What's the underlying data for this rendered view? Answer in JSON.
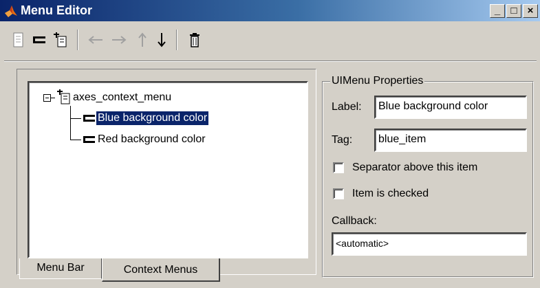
{
  "window": {
    "title": "Menu Editor",
    "controls": {
      "minimize": "_",
      "maximize": "□",
      "close": "×"
    }
  },
  "toolbar": {
    "icons": [
      "new-menu-icon",
      "new-menu-item-icon",
      "new-context-menu-icon",
      "move-left-icon",
      "move-right-icon",
      "move-up-icon",
      "move-down-icon",
      "delete-icon"
    ]
  },
  "tree": {
    "root": {
      "label": "axes_context_menu",
      "expanded": true
    },
    "items": [
      {
        "label": "Blue background color",
        "selected": true
      },
      {
        "label": "Red background color",
        "selected": false
      }
    ]
  },
  "tabs": [
    {
      "label": "Menu Bar",
      "active": false
    },
    {
      "label": "Context Menus",
      "active": true
    }
  ],
  "properties": {
    "group_title": "UIMenu Properties",
    "label_caption": "Label:",
    "label_value": "Blue background color",
    "tag_caption": "Tag:",
    "tag_value": "blue_item",
    "separator_caption": "Separator above this item",
    "separator_checked": false,
    "checked_caption": "Item is checked",
    "checked_checked": false,
    "callback_caption": "Callback:",
    "callback_value": "<automatic>"
  },
  "colors": {
    "selection": "#0a246a",
    "face": "#d4d0c8",
    "title_start": "#0a246a"
  }
}
